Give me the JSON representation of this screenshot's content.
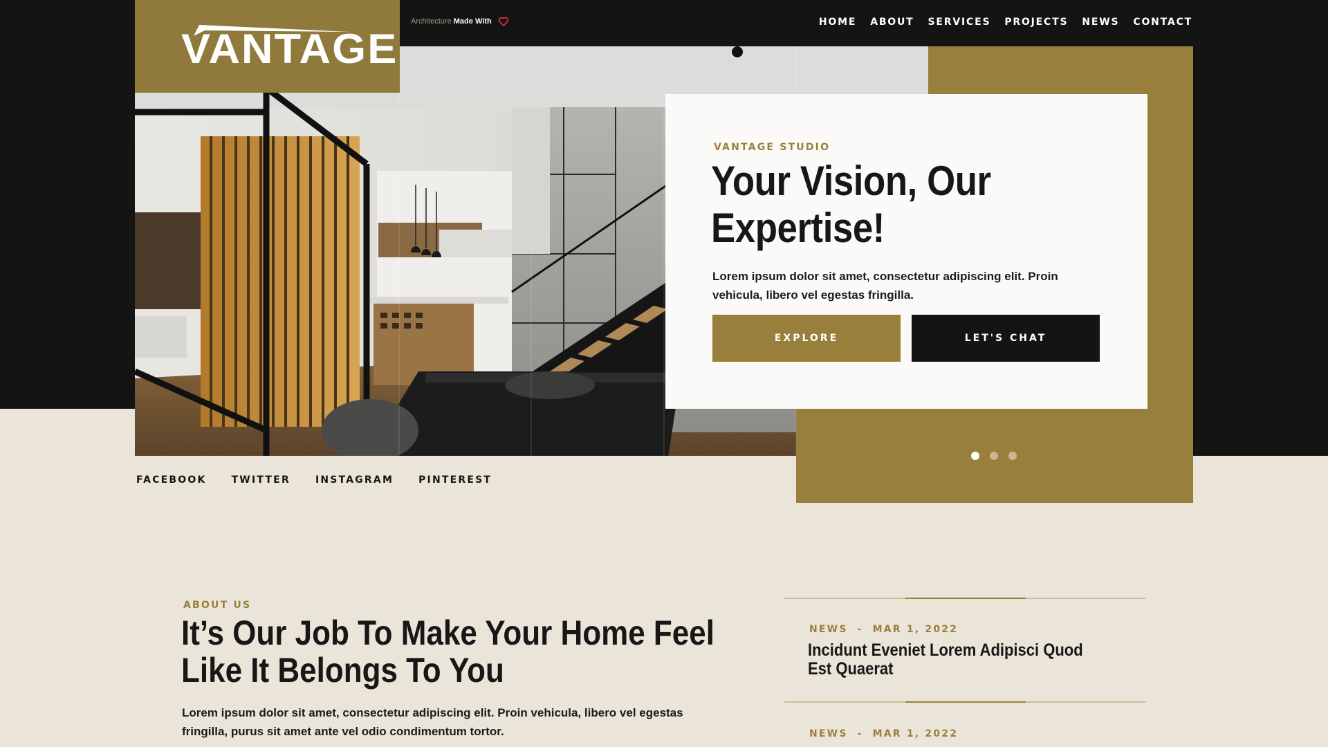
{
  "brand": {
    "logo_text": "VANTAGE",
    "tagline_prefix": "Architecture",
    "tagline_bold": "Made With"
  },
  "nav": [
    "HOME",
    "ABOUT",
    "SERVICES",
    "PROJECTS",
    "NEWS",
    "CONTACT"
  ],
  "hero": {
    "eyebrow": "VANTAGE STUDIO",
    "title": "Your Vision, Our Expertise!",
    "body": "Lorem ipsum dolor sit amet, consectetur adipiscing elit. Proin vehicula, libero vel egestas fringilla.",
    "explore_label": "EXPLORE",
    "chat_label": "LET'S CHAT",
    "slides_count": 3,
    "active_slide": 1
  },
  "social": [
    "FACEBOOK",
    "TWITTER",
    "INSTAGRAM",
    "PINTEREST"
  ],
  "about": {
    "eyebrow": "ABOUT US",
    "title": "It’s Our Job To Make Your Home Feel Like It Belongs To You",
    "body": "Lorem ipsum dolor sit amet, consectetur adipiscing elit. Proin vehicula, libero vel egestas fringilla, purus sit amet ante vel odio condimentum tortor."
  },
  "news": [
    {
      "category": "NEWS",
      "separator": "-",
      "date": "MAR 1, 2022",
      "title": "Incidunt Eveniet Lorem Adipisci Quod Est Quaerat"
    },
    {
      "category": "NEWS",
      "separator": "-",
      "date": "MAR 1, 2022",
      "title": ""
    }
  ],
  "colors": {
    "gold": "#98803c",
    "dark": "#141412",
    "cream": "#ebe5d9",
    "heart": "#e0334a"
  },
  "icons": {
    "heart": "heart-icon"
  }
}
